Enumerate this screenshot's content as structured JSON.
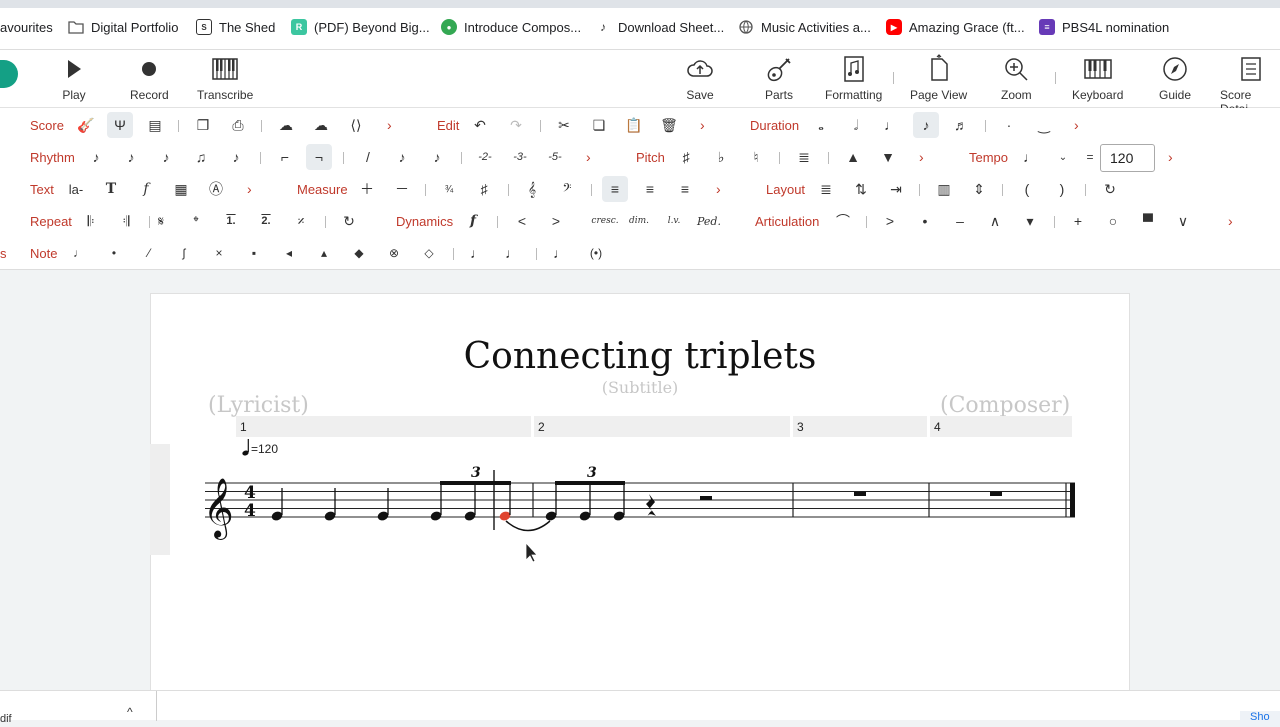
{
  "bookmarks": [
    {
      "label": "avourites",
      "icon": "star-icon"
    },
    {
      "label": "Digital Portfolio",
      "icon": "folder-icon"
    },
    {
      "label": "The Shed",
      "icon": "shed-logo-icon"
    },
    {
      "label": "(PDF) Beyond Big...",
      "icon": "researchgate-icon"
    },
    {
      "label": "Introduce Compos...",
      "icon": "green-circle-icon"
    },
    {
      "label": "Download Sheet...",
      "icon": "musescore-icon"
    },
    {
      "label": "Music Activities a...",
      "icon": "globe-icon"
    },
    {
      "label": "Amazing Grace (ft...",
      "icon": "youtube-icon"
    },
    {
      "label": "PBS4L nomination",
      "icon": "forms-icon"
    }
  ],
  "toolbar": {
    "play": "Play",
    "record": "Record",
    "transcribe": "Transcribe",
    "save": "Save",
    "parts": "Parts",
    "formatting": "Formatting",
    "page_view": "Page View",
    "zoom": "Zoom",
    "keyboard": "Keyboard",
    "guide": "Guide",
    "score_details": "Score Detai"
  },
  "ribbon": {
    "score": "Score",
    "edit": "Edit",
    "duration": "Duration",
    "rhythm": "Rhythm",
    "pitch": "Pitch",
    "tempo": "Tempo",
    "tempo_eq": "=",
    "tempo_value": "120",
    "text": "Text",
    "text_lyric": "la-",
    "text_bold": "T",
    "text_italic": "f",
    "measure": "Measure",
    "layout": "Layout",
    "repeat": "Repeat",
    "dynamics": "Dynamics",
    "dyn_f": "f",
    "dyn_cresc": "cresc.",
    "dyn_dim": "dim.",
    "dyn_lv": "l.v.",
    "dyn_ped": "Ped.",
    "articulation": "Articulation",
    "note": "Note",
    "tuplet_2": "-2-",
    "tuplet_3": "-3-",
    "tuplet_5": "-5-",
    "repeat_1": "1.",
    "repeat_2": "2."
  },
  "score": {
    "title": "Connecting triplets",
    "subtitle": "(Subtitle)",
    "lyricist": "(Lyricist)",
    "composer": "(Composer)",
    "measures": [
      "1",
      "2",
      "3",
      "4"
    ],
    "tempo_text": "=120",
    "time_sig_top": "4",
    "time_sig_bottom": "4",
    "triplet_label_1": "3",
    "triplet_label_2": "3",
    "selected_note_color": "#e0442f"
  },
  "bottom": {
    "left_text": "dif",
    "right_text": "Sho"
  },
  "colors": {
    "ribbon_label": "#c0392b",
    "logo": "#14a085"
  }
}
